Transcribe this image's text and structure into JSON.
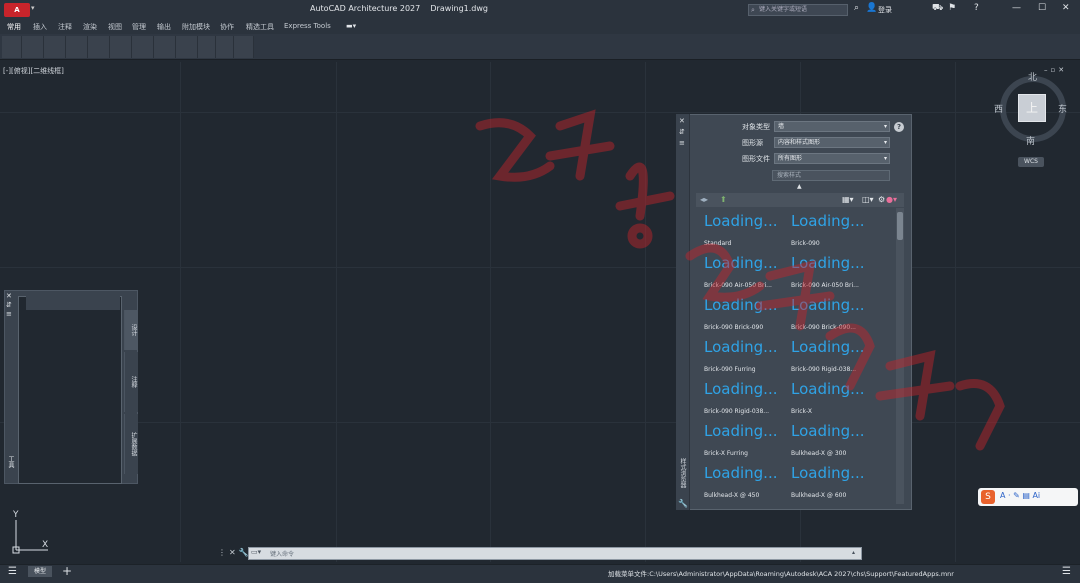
{
  "titlebar": {
    "app_button": "A",
    "title": "AutoCAD Architecture 2027    Drawing1.dwg",
    "search_placeholder": "键入关键字或短语",
    "login": "登录"
  },
  "menu": {
    "tabs": [
      "常用",
      "插入",
      "注释",
      "渲染",
      "视图",
      "管理",
      "输出",
      "附加模块",
      "协作",
      "精选工具",
      "Express Tools"
    ]
  },
  "viewport": {
    "label": "[-][俯视][二维线框]",
    "viewcube": {
      "top": "上",
      "north": "北",
      "south": "南",
      "east": "东",
      "west": "西",
      "wcs": "WCS"
    }
  },
  "left_palette": {
    "tabs": [
      "设计",
      "注释",
      "扩展数据"
    ],
    "bottom_label": "工具"
  },
  "style_palette": {
    "side_label": "样式浏览器",
    "object_type_label": "对象类型",
    "object_type_value": "墙",
    "source_label": "图形源",
    "source_value": "内容和样式图形",
    "file_label": "图形文件",
    "file_value": "所有图形",
    "search_placeholder": "搜索样式",
    "items": [
      {
        "status": "Loading...",
        "name": "Standard"
      },
      {
        "status": "Loading...",
        "name": "Brick-090"
      },
      {
        "status": "Loading...",
        "name": "Brick-090 Air-050 Bri..."
      },
      {
        "status": "Loading...",
        "name": "Brick-090 Air-050 Bri..."
      },
      {
        "status": "Loading...",
        "name": "Brick-090 Brick-090"
      },
      {
        "status": "Loading...",
        "name": "Brick-090 Brick-090..."
      },
      {
        "status": "Loading...",
        "name": "Brick-090 Furring"
      },
      {
        "status": "Loading...",
        "name": "Brick-090 Rigid-038..."
      },
      {
        "status": "Loading...",
        "name": "Brick-090 Rigid-038..."
      },
      {
        "status": "Loading...",
        "name": "Brick-X"
      },
      {
        "status": "Loading...",
        "name": "Brick-X Furring"
      },
      {
        "status": "Loading...",
        "name": "Bulkhead-X @ 300"
      },
      {
        "status": "Loading...",
        "name": "Bulkhead-X @ 450"
      },
      {
        "status": "Loading...",
        "name": "Bulkhead-X @ 600"
      }
    ]
  },
  "command": {
    "placeholder": "键入命令"
  },
  "ucs": {
    "x": "X",
    "y": "Y"
  },
  "statusbar": {
    "model_tab": "模型",
    "path": "加载菜单文件:C:\\Users\\Administrator\\AppData\\Roaming\\Autodesk\\ACA 2027\\chs\\Support\\FeaturedApps.mnr"
  },
  "ime": {
    "text": "A · ✎ ▤ Ai"
  },
  "colors": {
    "loading": "#2fa3e6",
    "background": "#212830",
    "watermark": "#c8242b"
  }
}
